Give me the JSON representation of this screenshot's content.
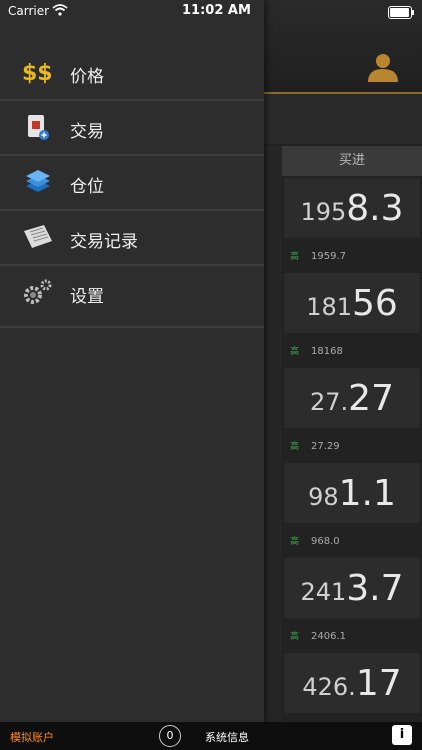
{
  "status_bar": {
    "carrier": "Carrier",
    "time": "11:02 AM"
  },
  "drawer": {
    "items": [
      {
        "label": "价格",
        "icon": "price-dollar-icon"
      },
      {
        "label": "交易",
        "icon": "trade-icon"
      },
      {
        "label": "仓位",
        "icon": "position-icon"
      },
      {
        "label": "交易记录",
        "icon": "trade-record-icon"
      },
      {
        "label": "设置",
        "icon": "settings-gear-icon"
      }
    ]
  },
  "quotes": {
    "column_header": "买进",
    "rows": [
      {
        "small": "195",
        "large": "8.3",
        "high_label": "高",
        "high": "1959.7"
      },
      {
        "small": "181",
        "large": "56",
        "high_label": "高",
        "high": "18168"
      },
      {
        "small": "27.",
        "large": "27",
        "high_label": "高",
        "high": "27.29"
      },
      {
        "small": "98",
        "large": "1.1",
        "high_label": "高",
        "high": "968.0"
      },
      {
        "small": "241",
        "large": "3.7",
        "high_label": "高",
        "high": "2406.1"
      },
      {
        "small": "426.",
        "large": "17",
        "high_label": "",
        "high": ""
      }
    ]
  },
  "bottom_bar": {
    "account_label": "模拟账户",
    "badge_count": "0",
    "system_info": "系统信息",
    "info_glyph": "i"
  },
  "colors": {
    "accent": "#ff8a1c",
    "high": "#3aa84a",
    "drawer_bg": "#2d2d2d"
  }
}
